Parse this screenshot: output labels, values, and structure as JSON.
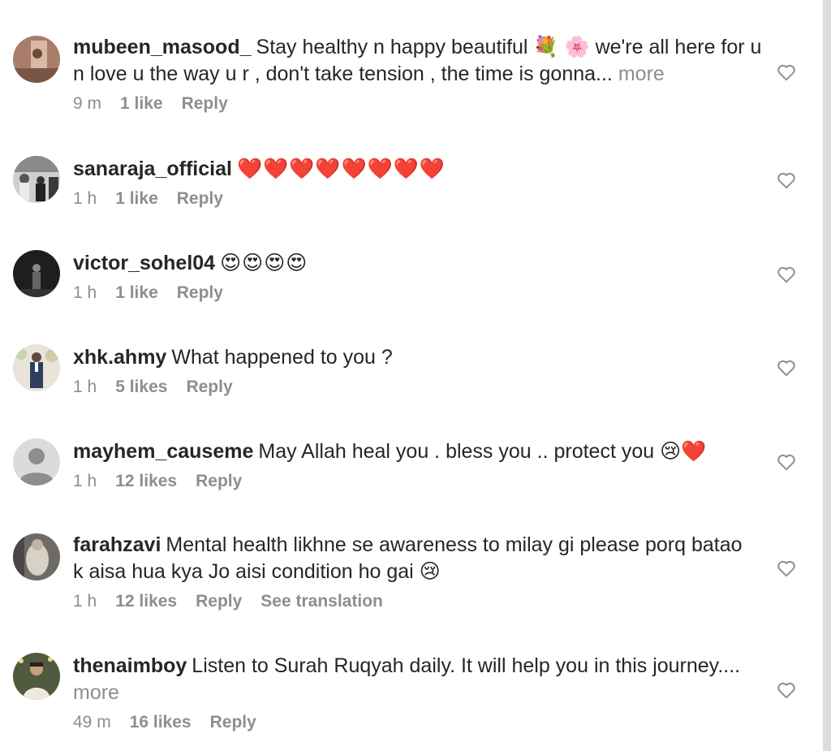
{
  "comments": [
    {
      "username": "mubeen_masood_",
      "text_line1": "Stay healthy n happy beautiful 💐 🌸 we're all here for u",
      "text_line2": "n love u the way u r , don't take tension , the time is gonna...",
      "more_label": "more",
      "time": "9 m",
      "likes": "1 like",
      "reply_label": "Reply",
      "avatar_icon": "avatar-photo-icon"
    },
    {
      "username": "sanaraja_official",
      "text": "❤️❤️❤️❤️❤️❤️❤️❤️",
      "time": "1 h",
      "likes": "1 like",
      "reply_label": "Reply",
      "avatar_icon": "avatar-photo-icon"
    },
    {
      "username": "victor_sohel04",
      "text": "😍😍😍😍",
      "time": "1 h",
      "likes": "1 like",
      "reply_label": "Reply",
      "avatar_icon": "avatar-photo-icon"
    },
    {
      "username": "xhk.ahmy",
      "text": "What happened to you ?",
      "time": "1 h",
      "likes": "5 likes",
      "reply_label": "Reply",
      "avatar_icon": "avatar-photo-icon"
    },
    {
      "username": "mayhem_causeme",
      "text": "May Allah heal you . bless you .. protect you 😢❤️",
      "time": "1 h",
      "likes": "12 likes",
      "reply_label": "Reply",
      "avatar_icon": "default-avatar-icon"
    },
    {
      "username": "farahzavi",
      "text_line1": "Mental health likhne se awareness to milay gi please porq batao",
      "text_line2": "k aisa hua kya Jo aisi condition ho gai 😢",
      "time": "1 h",
      "likes": "12 likes",
      "reply_label": "Reply",
      "translate_label": "See translation",
      "avatar_icon": "avatar-photo-icon"
    },
    {
      "username": "thenaimboy",
      "text_line1": "Listen to Surah Ruqyah daily. It will help you in this journey....",
      "more_label": "more",
      "time": "49 m",
      "likes": "16 likes",
      "reply_label": "Reply",
      "avatar_icon": "avatar-photo-icon"
    }
  ],
  "icons": {
    "like": "heart-outline-icon"
  },
  "colors": {
    "text": "#262626",
    "secondary": "#8e8e8e",
    "scrollbar": "#dcdcdc"
  }
}
